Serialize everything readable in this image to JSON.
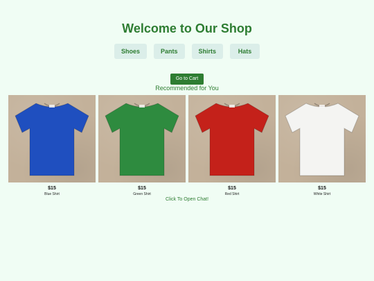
{
  "header": {
    "title": "Welcome to Our Shop"
  },
  "categories": [
    {
      "label": "Shoes"
    },
    {
      "label": "Pants"
    },
    {
      "label": "Shirts"
    },
    {
      "label": "Hats"
    }
  ],
  "cart": {
    "button_label": "Go to Cart"
  },
  "recommended": {
    "title": "Recommended for You",
    "products": [
      {
        "name": "Blue Shirt",
        "price": "$15",
        "color": "#1f4fbf",
        "image_icon": "t-shirt-icon"
      },
      {
        "name": "Green Shirt",
        "price": "$15",
        "color": "#2e8b3f",
        "image_icon": "t-shirt-icon"
      },
      {
        "name": "Red Shirt",
        "price": "$15",
        "color": "#c4211a",
        "image_icon": "t-shirt-icon"
      },
      {
        "name": "White Shirt",
        "price": "$15",
        "color": "#f4f4f2",
        "image_icon": "t-shirt-icon"
      }
    ]
  },
  "chat": {
    "link_label": "Click To Open Chat!"
  },
  "colors": {
    "accent": "#2e7d32",
    "background": "#f0fdf4",
    "category_button_bg": "#dbeee9"
  }
}
